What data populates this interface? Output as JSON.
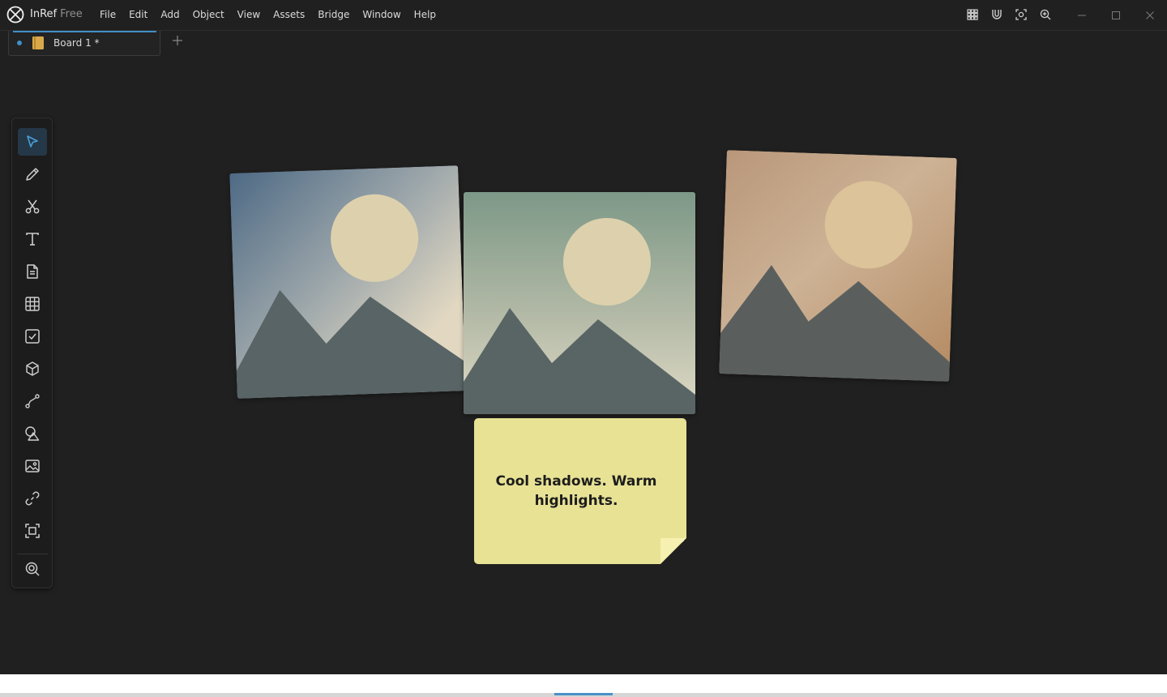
{
  "app": {
    "name": "InRef",
    "edition": "Free"
  },
  "menu": [
    "File",
    "Edit",
    "Add",
    "Object",
    "View",
    "Assets",
    "Bridge",
    "Window",
    "Help"
  ],
  "titlebar_icons": [
    "grid-icon",
    "magnet-icon",
    "focus-icon",
    "zoom-in-icon"
  ],
  "window_controls": [
    "minimize-icon",
    "maximize-icon",
    "close-icon"
  ],
  "tabs": [
    {
      "label": "Board 1 *",
      "active": true
    }
  ],
  "toolbar": {
    "tools": [
      "select",
      "pencil",
      "scissors",
      "text",
      "document",
      "table",
      "checkbox",
      "cube",
      "path",
      "shapes",
      "image",
      "link",
      "frame",
      "search"
    ],
    "active": "select"
  },
  "canvas": {
    "note": {
      "text": "Cool shadows. Warm highlights."
    }
  },
  "colors": {
    "accent": "#3f8fc7",
    "background": "#202020",
    "note": "#e8e295"
  }
}
